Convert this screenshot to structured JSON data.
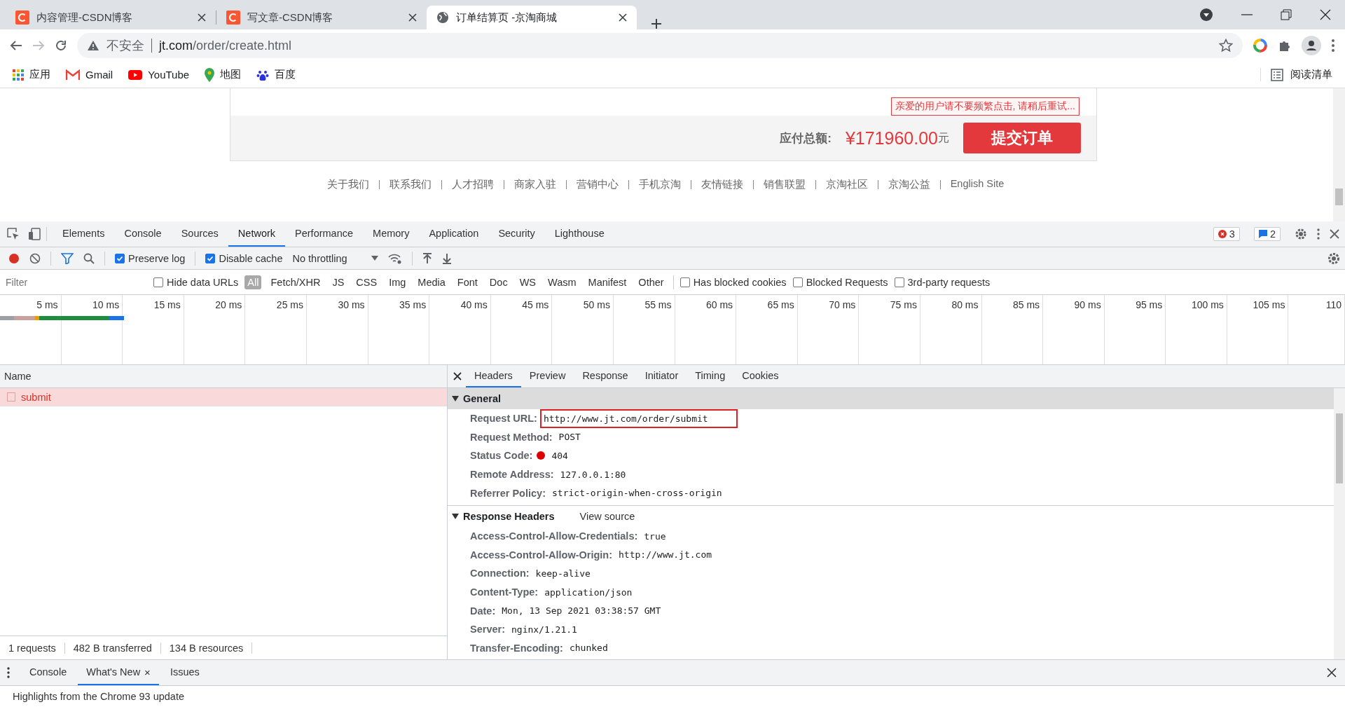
{
  "browser": {
    "tabs": [
      {
        "title": "内容管理-CSDN博客",
        "kind": "csdn",
        "selected": false
      },
      {
        "title": "写文章-CSDN博客",
        "kind": "csdn",
        "selected": false
      },
      {
        "title": "订单结算页 -京淘商城",
        "kind": "globe",
        "selected": true
      }
    ],
    "address": {
      "security": "不安全",
      "url_host": "jt.com",
      "url_path": "/order/create.html"
    },
    "bookmarks": [
      {
        "label": "应用",
        "kind": "apps"
      },
      {
        "label": "Gmail",
        "kind": "gmail"
      },
      {
        "label": "YouTube",
        "kind": "youtube"
      },
      {
        "label": "地图",
        "kind": "maps"
      },
      {
        "label": "百度",
        "kind": "paw"
      }
    ],
    "reading_list": "阅读清单"
  },
  "page": {
    "warning": "亲爱的用户请不要频繁点击, 请稍后重试...",
    "total_label": "应付总额:",
    "total": "¥171960.00",
    "currency": "元",
    "submit": "提交订单",
    "footer_links": [
      "关于我们",
      "联系我们",
      "人才招聘",
      "商家入驻",
      "营销中心",
      "手机京淘",
      "友情链接",
      "销售联盟",
      "京淘社区",
      "京淘公益",
      "English Site"
    ]
  },
  "devtools": {
    "tabs": [
      {
        "label": "Elements",
        "selected": false
      },
      {
        "label": "Console",
        "selected": false
      },
      {
        "label": "Sources",
        "selected": false
      },
      {
        "label": "Network",
        "selected": true
      },
      {
        "label": "Performance",
        "selected": false
      },
      {
        "label": "Memory",
        "selected": false
      },
      {
        "label": "Application",
        "selected": false
      },
      {
        "label": "Security",
        "selected": false
      },
      {
        "label": "Lighthouse",
        "selected": false
      }
    ],
    "errors": "3",
    "messages": "2",
    "preserve_log": {
      "label": "Preserve log",
      "checked": true
    },
    "disable_cache": {
      "label": "Disable cache",
      "checked": true
    },
    "throttling": "No throttling",
    "filter": {
      "placeholder": "Filter"
    },
    "hide_data_urls": {
      "label": "Hide data URLs",
      "checked": false
    },
    "type_filters": [
      {
        "label": "All",
        "selected": true
      },
      {
        "label": "Fetch/XHR",
        "selected": false
      },
      {
        "label": "JS",
        "selected": false
      },
      {
        "label": "CSS",
        "selected": false
      },
      {
        "label": "Img",
        "selected": false
      },
      {
        "label": "Media",
        "selected": false
      },
      {
        "label": "Font",
        "selected": false
      },
      {
        "label": "Doc",
        "selected": false
      },
      {
        "label": "WS",
        "selected": false
      },
      {
        "label": "Wasm",
        "selected": false
      },
      {
        "label": "Manifest",
        "selected": false
      },
      {
        "label": "Other",
        "selected": false
      }
    ],
    "extra_filters": [
      {
        "label": "Has blocked cookies",
        "checked": false
      },
      {
        "label": "Blocked Requests",
        "checked": false
      },
      {
        "label": "3rd-party requests",
        "checked": false
      }
    ],
    "timeline_ticks": [
      "5 ms",
      "10 ms",
      "15 ms",
      "20 ms",
      "25 ms",
      "30 ms",
      "35 ms",
      "40 ms",
      "45 ms",
      "50 ms",
      "55 ms",
      "60 ms",
      "65 ms",
      "70 ms",
      "75 ms",
      "80 ms",
      "85 ms",
      "90 ms",
      "95 ms",
      "100 ms",
      "105 ms",
      "110"
    ],
    "name_column": "Name",
    "requests": [
      {
        "name": "submit",
        "selected": true,
        "failed": true
      }
    ],
    "status_bar": [
      "1 requests",
      "482 B transferred",
      "134 B resources"
    ],
    "detail_tabs": [
      {
        "label": "Headers",
        "selected": true
      },
      {
        "label": "Preview",
        "selected": false
      },
      {
        "label": "Response",
        "selected": false
      },
      {
        "label": "Initiator",
        "selected": false
      },
      {
        "label": "Timing",
        "selected": false
      },
      {
        "label": "Cookies",
        "selected": false
      }
    ],
    "general": {
      "title": "General",
      "expanded": true,
      "rows": [
        {
          "name": "Request URL:",
          "value": "http://www.jt.com/order/submit",
          "highlighted": true,
          "kind": "text"
        },
        {
          "name": "Request Method:",
          "value": "POST",
          "highlighted": false,
          "kind": "text"
        },
        {
          "name": "Status Code:",
          "value": "404",
          "highlighted": false,
          "kind": "status"
        },
        {
          "name": "Remote Address:",
          "value": "127.0.0.1:80",
          "highlighted": false,
          "kind": "text"
        },
        {
          "name": "Referrer Policy:",
          "value": "strict-origin-when-cross-origin",
          "highlighted": false,
          "kind": "text"
        }
      ]
    },
    "response_headers": {
      "title": "Response Headers",
      "expanded": true,
      "view_source": "View source",
      "rows": [
        {
          "name": "Access-Control-Allow-Credentials:",
          "value": "true"
        },
        {
          "name": "Access-Control-Allow-Origin:",
          "value": "http://www.jt.com"
        },
        {
          "name": "Connection:",
          "value": "keep-alive"
        },
        {
          "name": "Content-Type:",
          "value": "application/json"
        },
        {
          "name": "Date:",
          "value": "Mon, 13 Sep 2021 03:38:57 GMT"
        },
        {
          "name": "Server:",
          "value": "nginx/1.21.1"
        },
        {
          "name": "Transfer-Encoding:",
          "value": "chunked"
        }
      ]
    },
    "drawer_tabs": [
      {
        "label": "Console",
        "selected": false,
        "closable": false
      },
      {
        "label": "What's New",
        "selected": true,
        "closable": true
      },
      {
        "label": "Issues",
        "selected": false,
        "closable": false
      }
    ],
    "close_mark": "×",
    "highlights": "Highlights from the Chrome 93 update"
  }
}
